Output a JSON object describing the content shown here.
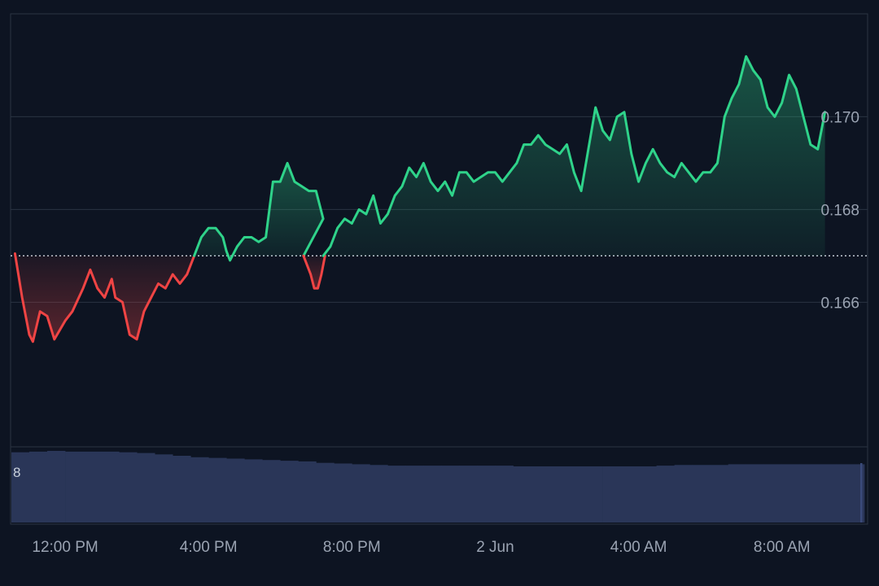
{
  "colors": {
    "background": "#0d1422",
    "up": "#2fd38a",
    "down": "#ef4444",
    "grid": "#2a3342",
    "volume": "#2a3658",
    "axis_text": "#9aa3b2"
  },
  "chart_data": {
    "type": "area",
    "baseline": 0.167,
    "ylim": [
      0.1629,
      0.1722
    ],
    "y_ticks": [
      "0.170",
      "0.168",
      "0.166"
    ],
    "y_tick_values": [
      0.17,
      0.168,
      0.166
    ],
    "x_range": [
      10.5,
      34.3
    ],
    "x_tick_labels": [
      "12:00 PM",
      "4:00 PM",
      "8:00 PM",
      "2 Jun",
      "4:00 AM",
      "8:00 AM"
    ],
    "x_tick_hours": [
      12,
      16,
      20,
      24,
      28,
      32
    ],
    "grid": "horizontal",
    "price": {
      "x": [
        10.5,
        10.6,
        10.7,
        10.8,
        10.9,
        11.0,
        11.2,
        11.4,
        11.6,
        11.8,
        12.0,
        12.2,
        12.4,
        12.5,
        12.7,
        12.9,
        13.1,
        13.2,
        13.4,
        13.6,
        13.8,
        14.0,
        14.2,
        14.4,
        14.6,
        14.8,
        14.9,
        15.1,
        15.2,
        15.3,
        15.4,
        15.5,
        15.7,
        15.9,
        16.0,
        16.2,
        16.4,
        16.6,
        16.8,
        17.0,
        17.2,
        17.4,
        17.6,
        17.8,
        18.0,
        18.2,
        18.5,
        18.8,
        19.0,
        19.2,
        19.4,
        19.6,
        19.8,
        20.0,
        20.2,
        20.4,
        20.6,
        20.8,
        21.0,
        21.2,
        21.5,
        21.8,
        22.0,
        22.3,
        22.6,
        22.9,
        23.1,
        23.3,
        23.6,
        23.9,
        24.2,
        24.5,
        24.8,
        25.1,
        25.4,
        25.7,
        26.0,
        26.3,
        26.6,
        26.9,
        27.2,
        27.5,
        27.8,
        28.0,
        28.2,
        28.4,
        28.6,
        28.8,
        29.0,
        29.2,
        29.4,
        29.6,
        29.8,
        30.0,
        30.2,
        30.4,
        30.6,
        30.8,
        31.0,
        31.2,
        31.4,
        31.6,
        31.8,
        32.0,
        32.2,
        32.4,
        32.6,
        32.8,
        33.0,
        33.2,
        33.4,
        33.6,
        33.8,
        34.0,
        34.2
      ],
      "y": [
        0.167,
        0.1671,
        0.1668,
        0.1662,
        0.1656,
        0.1652,
        0.1654,
        0.1656,
        0.1652,
        0.1655,
        0.166,
        0.1666,
        0.1669,
        0.1665,
        0.166,
        0.1656,
        0.165,
        0.1653,
        0.166,
        0.1662,
        0.1664,
        0.1667,
        0.1673,
        0.1675,
        0.167,
        0.1671,
        0.1676,
        0.1682,
        0.1684,
        0.1683,
        0.168,
        0.1676,
        0.1673,
        0.167,
        0.1669,
        0.1661,
        0.1664,
        0.1662,
        0.1663,
        0.1671,
        0.1677,
        0.168,
        0.1678,
        0.1684,
        0.1686,
        0.169,
        0.1687,
        0.1686,
        0.1682,
        0.1676,
        0.1682,
        0.1684,
        0.1687,
        0.1686,
        0.169,
        0.1686,
        0.1695,
        0.1688,
        0.1683,
        0.1692,
        0.1692,
        0.1692,
        0.169,
        0.1694,
        0.1696,
        0.1697,
        0.1696,
        0.1695,
        0.1694,
        0.1693,
        0.169,
        0.1688,
        0.169,
        0.1695,
        0.1696,
        0.1692,
        0.169,
        0.1693,
        0.1702,
        0.1696,
        0.1698,
        0.1696,
        0.1698,
        0.169,
        0.1684,
        0.1693,
        0.17,
        0.171,
        0.1698,
        0.1693,
        0.1694,
        0.1695,
        0.1698,
        0.17,
        0.1697,
        0.169,
        0.1691,
        0.169,
        0.1688,
        0.1689,
        0.169,
        0.1697,
        0.1705,
        0.1713,
        0.1716,
        0.1712,
        0.1708,
        0.1704,
        0.1706,
        0.1707,
        0.1704,
        0.17,
        0.1697,
        0.1693,
        0.1701
      ],
      "down_ranges": [
        [
          10.5,
          15.6
        ],
        [
          18.6,
          19.2
        ]
      ],
      "down_dip_points": [
        [
          10.6,
          0.16705
        ],
        [
          10.8,
          0.1661
        ],
        [
          11.0,
          0.1653
        ],
        [
          11.1,
          0.16515
        ],
        [
          11.3,
          0.1658
        ],
        [
          11.5,
          0.1657
        ],
        [
          11.7,
          0.1652
        ],
        [
          12.0,
          0.1656
        ],
        [
          12.2,
          0.1658
        ],
        [
          12.5,
          0.1663
        ],
        [
          12.7,
          0.1667
        ],
        [
          12.9,
          0.1663
        ],
        [
          13.1,
          0.1661
        ],
        [
          13.3,
          0.1665
        ],
        [
          13.4,
          0.1661
        ],
        [
          13.6,
          0.166
        ],
        [
          13.8,
          0.1653
        ],
        [
          14.0,
          0.1652
        ],
        [
          14.2,
          0.1658
        ],
        [
          14.4,
          0.1661
        ],
        [
          14.6,
          0.1664
        ],
        [
          14.8,
          0.1663
        ],
        [
          15.0,
          0.1666
        ],
        [
          15.2,
          0.1664
        ],
        [
          15.4,
          0.1666
        ],
        [
          15.6,
          0.167
        ],
        [
          18.6,
          0.167
        ],
        [
          18.8,
          0.1666
        ],
        [
          18.9,
          0.1663
        ],
        [
          19.0,
          0.1663
        ],
        [
          19.1,
          0.1666
        ],
        [
          19.2,
          0.167
        ]
      ],
      "up_points": [
        [
          15.6,
          0.167
        ],
        [
          15.8,
          0.1674
        ],
        [
          16.0,
          0.1676
        ],
        [
          16.2,
          0.1676
        ],
        [
          16.4,
          0.1674
        ],
        [
          16.5,
          0.1671
        ],
        [
          16.6,
          0.1669
        ],
        [
          16.8,
          0.1672
        ],
        [
          17.0,
          0.1674
        ],
        [
          17.2,
          0.1674
        ],
        [
          17.4,
          0.1673
        ],
        [
          17.6,
          0.1674
        ],
        [
          17.8,
          0.1686
        ],
        [
          18.0,
          0.1686
        ],
        [
          18.2,
          0.169
        ],
        [
          18.4,
          0.1686
        ],
        [
          18.6,
          0.1685
        ],
        [
          18.8,
          0.1684
        ],
        [
          19.0,
          0.1684
        ],
        [
          19.2,
          0.1678
        ],
        [
          19.4,
          0.167
        ],
        [
          19.2,
          0.167
        ],
        [
          19.4,
          0.1672
        ],
        [
          19.6,
          0.1676
        ],
        [
          19.8,
          0.1678
        ],
        [
          20.0,
          0.1677
        ],
        [
          20.2,
          0.168
        ],
        [
          20.4,
          0.1679
        ],
        [
          20.6,
          0.1683
        ],
        [
          20.8,
          0.1677
        ],
        [
          21.0,
          0.1679
        ],
        [
          21.2,
          0.1683
        ],
        [
          21.4,
          0.1685
        ],
        [
          21.6,
          0.1689
        ],
        [
          21.8,
          0.1687
        ],
        [
          22.0,
          0.169
        ],
        [
          22.2,
          0.1686
        ],
        [
          22.4,
          0.1684
        ],
        [
          22.6,
          0.1686
        ],
        [
          22.8,
          0.1683
        ],
        [
          23.0,
          0.1688
        ],
        [
          23.2,
          0.1688
        ],
        [
          23.4,
          0.1686
        ],
        [
          23.6,
          0.1687
        ],
        [
          23.8,
          0.1688
        ],
        [
          24.0,
          0.1688
        ],
        [
          24.2,
          0.1686
        ],
        [
          24.4,
          0.1688
        ],
        [
          24.6,
          0.169
        ],
        [
          24.8,
          0.1694
        ],
        [
          25.0,
          0.1694
        ],
        [
          25.2,
          0.1696
        ],
        [
          25.4,
          0.1694
        ],
        [
          25.6,
          0.1693
        ],
        [
          25.8,
          0.1692
        ],
        [
          26.0,
          0.1694
        ],
        [
          26.2,
          0.1688
        ],
        [
          26.4,
          0.1684
        ],
        [
          26.6,
          0.1693
        ],
        [
          26.8,
          0.1702
        ],
        [
          27.0,
          0.1697
        ],
        [
          27.2,
          0.1695
        ],
        [
          27.4,
          0.17
        ],
        [
          27.6,
          0.1701
        ],
        [
          27.8,
          0.1692
        ],
        [
          28.0,
          0.1686
        ],
        [
          28.2,
          0.169
        ],
        [
          28.4,
          0.1693
        ],
        [
          28.6,
          0.169
        ],
        [
          28.8,
          0.1688
        ],
        [
          29.0,
          0.1687
        ],
        [
          29.2,
          0.169
        ],
        [
          29.4,
          0.1688
        ],
        [
          29.6,
          0.1686
        ],
        [
          29.8,
          0.1688
        ],
        [
          30.0,
          0.1688
        ],
        [
          30.2,
          0.169
        ],
        [
          30.4,
          0.17
        ],
        [
          30.6,
          0.1704
        ],
        [
          30.8,
          0.1707
        ],
        [
          31.0,
          0.1713
        ],
        [
          31.2,
          0.171
        ],
        [
          31.4,
          0.1708
        ],
        [
          31.6,
          0.1702
        ],
        [
          31.8,
          0.17
        ],
        [
          32.0,
          0.1703
        ],
        [
          32.2,
          0.1709
        ],
        [
          32.4,
          0.1706
        ],
        [
          32.6,
          0.17
        ],
        [
          32.8,
          0.1694
        ],
        [
          33.0,
          0.1693
        ],
        [
          33.2,
          0.1701
        ]
      ]
    },
    "volume": {
      "label": "8",
      "x": [
        10.5,
        11.0,
        11.5,
        12.0,
        12.5,
        13.0,
        13.5,
        14.0,
        14.5,
        15.0,
        15.5,
        16.0,
        16.5,
        17.0,
        17.5,
        18.0,
        18.5,
        19.0,
        19.5,
        20.0,
        20.5,
        21.0,
        21.5,
        22.0,
        22.5,
        23.0,
        23.5,
        24.0,
        24.5,
        25.0,
        25.5,
        26.0,
        26.5,
        27.0,
        27.5,
        28.0,
        28.5,
        29.0,
        29.5,
        30.0,
        30.5,
        31.0,
        31.5,
        32.0,
        32.5,
        33.0,
        33.5,
        34.0,
        34.3
      ],
      "values": [
        10.0,
        10.1,
        10.2,
        10.1,
        10.1,
        10.1,
        10.0,
        9.9,
        9.7,
        9.5,
        9.3,
        9.2,
        9.1,
        9.0,
        8.9,
        8.8,
        8.7,
        8.5,
        8.4,
        8.3,
        8.2,
        8.1,
        8.1,
        8.1,
        8.1,
        8.1,
        8.1,
        8.1,
        8.0,
        8.0,
        8.0,
        8.0,
        8.0,
        8.0,
        8.0,
        8.0,
        8.1,
        8.2,
        8.2,
        8.2,
        8.3,
        8.3,
        8.3,
        8.3,
        8.3,
        8.3,
        8.3,
        8.3,
        8.3
      ],
      "vmax": 10.2
    }
  }
}
